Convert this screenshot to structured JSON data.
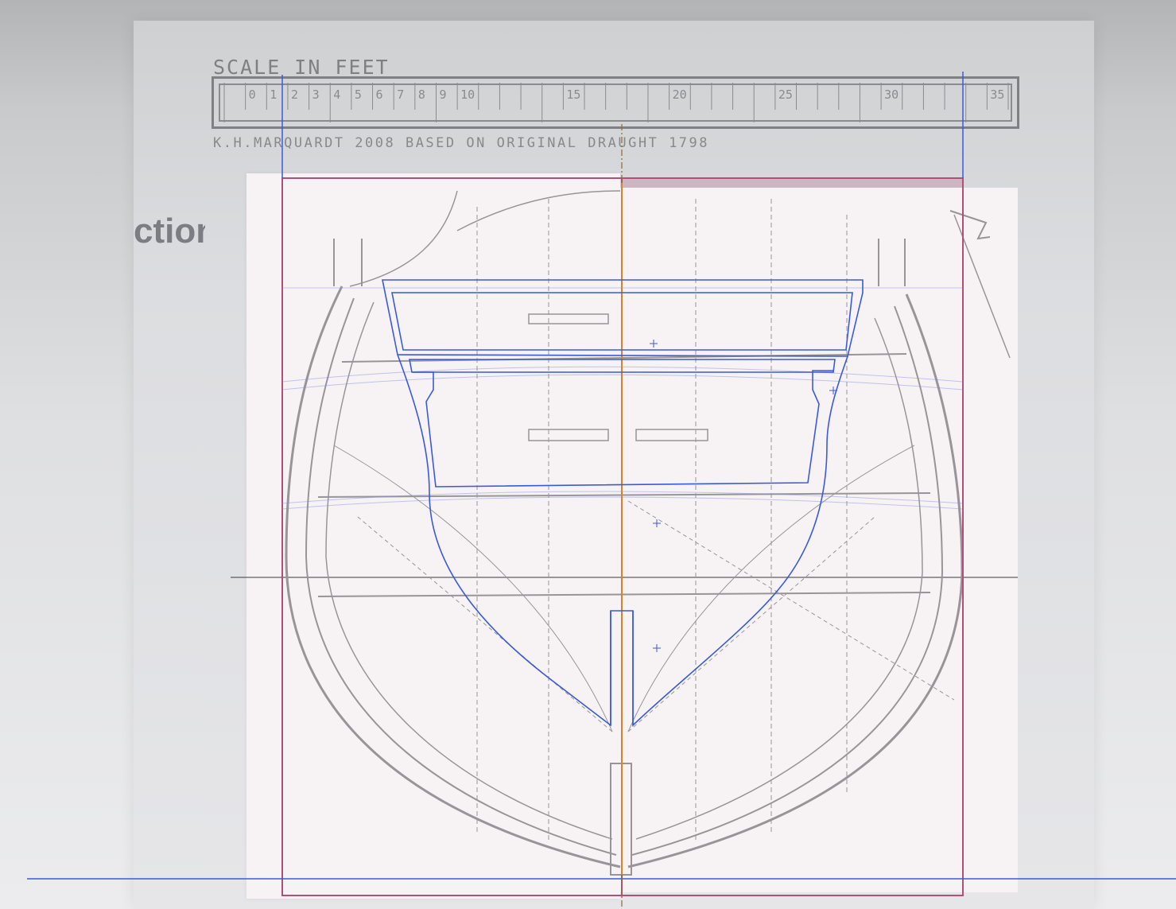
{
  "reference_image": {
    "scale_title": "SCALE IN FEET",
    "scale_numbers": [
      "0",
      "1",
      "2",
      "3",
      "4",
      "5",
      "6",
      "7",
      "8",
      "9",
      "10",
      "15",
      "20",
      "25",
      "30",
      "35"
    ],
    "credit": "K.H.MARQUARDT 2008   BASED ON ORIGINAL DRAUGHT 1798",
    "section_label_partial": "ction"
  },
  "colors": {
    "guide_blue": "#3a5bd9",
    "frame_crimson": "#b0507a",
    "centerline_orange": "#d9822b",
    "drawing_ink": "#4a4a4e",
    "sheet": "#f7f2f4"
  },
  "icons": {
    "handle": "plus-crosshair-icon"
  }
}
